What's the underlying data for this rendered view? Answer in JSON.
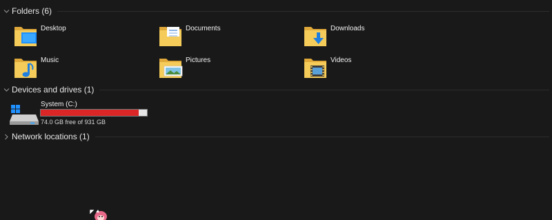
{
  "folders": {
    "header": "Folders (6)",
    "items": [
      {
        "label": "Desktop",
        "icon": "desktop-folder-icon"
      },
      {
        "label": "Documents",
        "icon": "documents-folder-icon"
      },
      {
        "label": "Downloads",
        "icon": "downloads-folder-icon"
      },
      {
        "label": "Music",
        "icon": "music-folder-icon"
      },
      {
        "label": "Pictures",
        "icon": "pictures-folder-icon"
      },
      {
        "label": "Videos",
        "icon": "videos-folder-icon"
      }
    ]
  },
  "devices": {
    "header": "Devices and drives (1)",
    "drive": {
      "name": "System (C:)",
      "free_text": "74.0 GB free of 931 GB",
      "used_fraction": 0.92,
      "bar_color": "#da2626"
    }
  },
  "network": {
    "header": "Network locations (1)"
  },
  "colors": {
    "background": "#191919",
    "folder_yellow": "#f2c94c",
    "accent_blue": "#1e90ff"
  }
}
